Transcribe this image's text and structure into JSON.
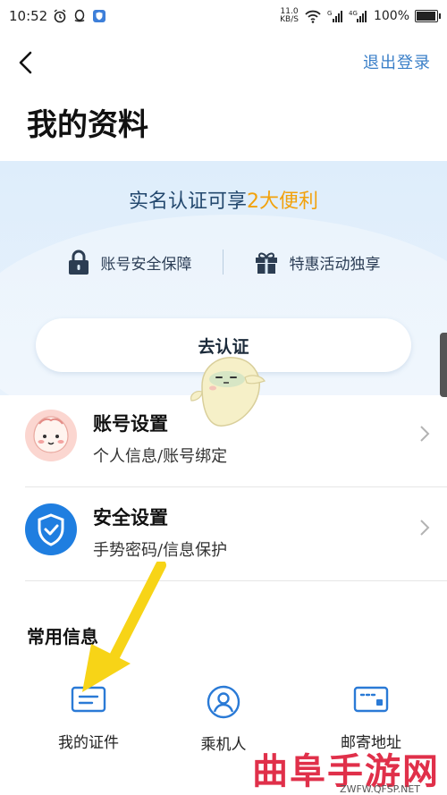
{
  "status_bar": {
    "time": "10:52",
    "net_speed_value": "11.0",
    "net_speed_unit": "KB/S",
    "battery": "100%",
    "battery_level": 1.0,
    "icons": [
      "alarm-icon",
      "qq-icon",
      "shield-app-icon",
      "wifi-icon",
      "signal-icon",
      "signal-4g-icon",
      "battery-icon"
    ]
  },
  "header": {
    "logout_label": "退出登录",
    "title": "我的资料"
  },
  "verify": {
    "heading_prefix": "实名认证可享",
    "heading_highlight": "2大便利",
    "benefits": [
      {
        "label": "账号安全保障",
        "icon": "lock-icon"
      },
      {
        "label": "特惠活动独享",
        "icon": "gift-icon"
      }
    ],
    "button_label": "去认证",
    "highlight_color": "#f2a20c",
    "heading_color": "#23486e"
  },
  "settings": [
    {
      "title": "账号设置",
      "subtitle": "个人信息/账号绑定",
      "icon": "avatar-icon"
    },
    {
      "title": "安全设置",
      "subtitle": "手势密码/信息保护",
      "icon": "shield-check-icon"
    }
  ],
  "common_info": {
    "title": "常用信息",
    "shortcuts": [
      {
        "label": "我的证件",
        "icon": "id-card-icon"
      },
      {
        "label": "乘机人",
        "icon": "passenger-icon"
      },
      {
        "label": "邮寄地址",
        "icon": "address-card-icon"
      }
    ]
  },
  "watermark": {
    "text": "曲阜手游网",
    "url": "ZWFW.QFSP.NET"
  },
  "colors": {
    "accent_blue": "#3a7fc8",
    "panel_bg": "#deedfb",
    "arrow_yellow": "#f7d417",
    "watermark_red": "#e0304a"
  }
}
